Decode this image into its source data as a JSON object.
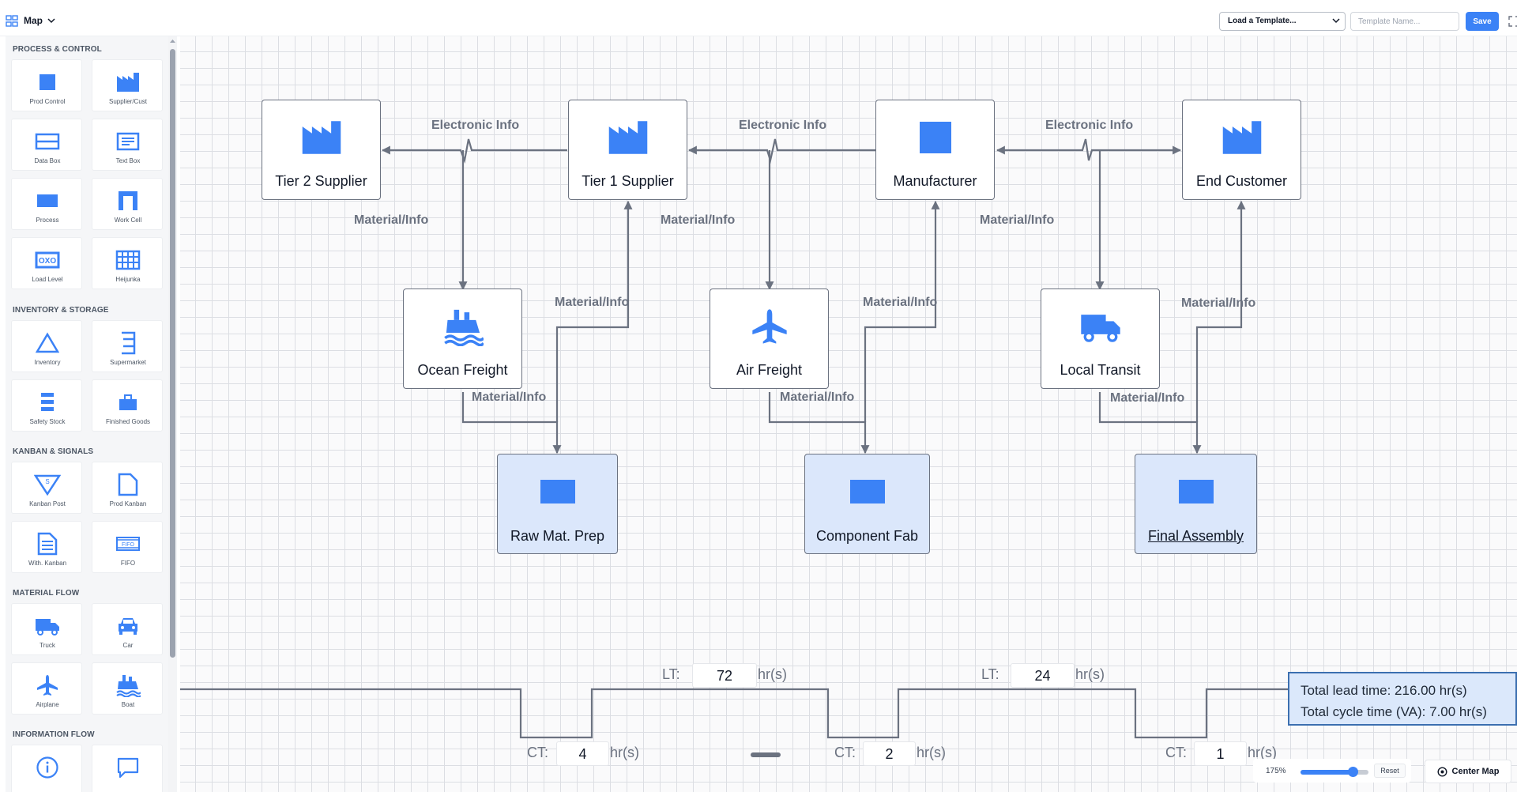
{
  "header": {
    "view_label": "Map",
    "template_select": "Load a Template...",
    "template_name_placeholder": "Template Name...",
    "save_label": "Save"
  },
  "sidebar": {
    "sections": [
      {
        "title": "PROCESS & CONTROL",
        "items": [
          {
            "label": "Prod Control",
            "icon": "square-icon"
          },
          {
            "label": "Supplier/Cust",
            "icon": "factory-icon"
          },
          {
            "label": "Data Box",
            "icon": "data-box-icon"
          },
          {
            "label": "Text Box",
            "icon": "text-box-icon"
          },
          {
            "label": "Process",
            "icon": "process-icon"
          },
          {
            "label": "Work Cell",
            "icon": "work-cell-icon"
          },
          {
            "label": "Load Level",
            "icon": "load-level-icon"
          },
          {
            "label": "Heijunka",
            "icon": "heijunka-icon"
          }
        ]
      },
      {
        "title": "INVENTORY & STORAGE",
        "items": [
          {
            "label": "Inventory",
            "icon": "triangle-icon"
          },
          {
            "label": "Supermarket",
            "icon": "supermarket-icon"
          },
          {
            "label": "Safety Stock",
            "icon": "safety-stock-icon"
          },
          {
            "label": "Finished Goods",
            "icon": "briefcase-icon"
          }
        ]
      },
      {
        "title": "KANBAN & SIGNALS",
        "items": [
          {
            "label": "Kanban Post",
            "icon": "kanban-post-icon"
          },
          {
            "label": "Prod Kanban",
            "icon": "prod-kanban-icon"
          },
          {
            "label": "With. Kanban",
            "icon": "withdrawal-kanban-icon"
          },
          {
            "label": "FIFO",
            "icon": "fifo-icon"
          }
        ]
      },
      {
        "title": "MATERIAL FLOW",
        "items": [
          {
            "label": "Truck",
            "icon": "truck-icon"
          },
          {
            "label": "Car",
            "icon": "car-icon"
          },
          {
            "label": "Airplane",
            "icon": "airplane-icon"
          },
          {
            "label": "Boat",
            "icon": "boat-icon"
          }
        ]
      },
      {
        "title": "INFORMATION FLOW",
        "items": [
          {
            "label": "",
            "icon": "info-icon"
          },
          {
            "label": "",
            "icon": "chat-bubble-icon"
          }
        ]
      }
    ]
  },
  "map": {
    "nodes": [
      {
        "id": "tier2",
        "label": "Tier 2 Supplier",
        "icon": "factory-icon",
        "type": "supplier"
      },
      {
        "id": "tier1",
        "label": "Tier 1 Supplier",
        "icon": "factory-icon",
        "type": "supplier"
      },
      {
        "id": "manufacturer",
        "label": "Manufacturer",
        "icon": "square-icon",
        "type": "control"
      },
      {
        "id": "customer",
        "label": "End Customer",
        "icon": "factory-icon",
        "type": "customer"
      },
      {
        "id": "ocean",
        "label": "Ocean Freight",
        "icon": "boat-icon",
        "type": "transport"
      },
      {
        "id": "air",
        "label": "Air Freight",
        "icon": "airplane-icon",
        "type": "transport"
      },
      {
        "id": "local",
        "label": "Local Transit",
        "icon": "truck-icon",
        "type": "transport"
      },
      {
        "id": "rawprep",
        "label": "Raw Mat. Prep",
        "icon": "process-icon",
        "type": "process"
      },
      {
        "id": "compfab",
        "label": "Component Fab",
        "icon": "process-icon",
        "type": "process"
      },
      {
        "id": "finalasm",
        "label": "Final Assembly",
        "icon": "process-icon",
        "type": "process"
      }
    ],
    "flow_labels": {
      "electronic": "Electronic Info",
      "material": "Material/Info"
    }
  },
  "timeline": {
    "lt_label": "LT:",
    "ct_label": "CT:",
    "unit": "hr(s)",
    "lead_times": [
      "72",
      "24"
    ],
    "cycle_times": [
      "4",
      "2",
      "1"
    ],
    "total_lead": "Total lead time: 216.00 hr(s)",
    "total_cycle": "Total cycle time (VA): 7.00 hr(s)"
  },
  "zoom": {
    "value_label": "175%",
    "level": 0.78,
    "reset_label": "Reset",
    "center_label": "Center Map"
  },
  "colors": {
    "accent": "#3b82f6",
    "line": "#6b7280",
    "process_fill": "#dbe7fb"
  }
}
